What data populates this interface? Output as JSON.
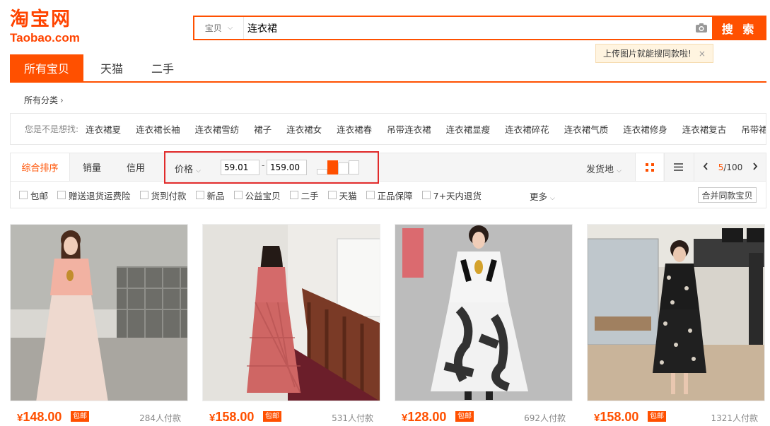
{
  "logo": {
    "cn": "淘宝网",
    "en": "Taobao.com"
  },
  "search": {
    "category": "宝贝",
    "query": "连衣裙",
    "button": "搜 索",
    "tip": "上传图片就能搜同款啦!",
    "tip_close": "×"
  },
  "tabs": [
    {
      "label": "所有宝贝",
      "active": true
    },
    {
      "label": "天猫"
    },
    {
      "label": "二手"
    }
  ],
  "breadcrumb": {
    "label": "所有分类",
    "arrow": "›"
  },
  "suggestions": {
    "label": "您是不是想找:",
    "items": [
      "连衣裙夏",
      "连衣裙长袖",
      "连衣裙雪纺",
      "裙子",
      "连衣裙女",
      "连衣裙春",
      "吊带连衣裙",
      "连衣裙显瘦",
      "连衣裙碎花",
      "连衣裙气质",
      "连衣裙修身",
      "连衣裙复古",
      "吊带裙"
    ]
  },
  "sort": {
    "items": [
      "综合排序",
      "销量",
      "信用"
    ],
    "price_label": "价格",
    "price_min": "59.01",
    "price_dash": "-",
    "price_max": "159.00",
    "ship_from": "发货地",
    "page_current": "5",
    "page_total": "/100"
  },
  "checks": [
    "包邮",
    "赠送退货运费险",
    "货到付款",
    "新品",
    "公益宝贝",
    "二手",
    "天猫",
    "正品保障",
    "7+天内退货"
  ],
  "more_label": "更多",
  "merge_label": "合并同款宝贝",
  "products": [
    {
      "price": "148.00",
      "currency": "¥",
      "badge": "包邮",
      "sold": "284人付款"
    },
    {
      "price": "158.00",
      "currency": "¥",
      "badge": "包邮",
      "sold": "531人付款"
    },
    {
      "price": "128.00",
      "currency": "¥",
      "badge": "包邮",
      "sold": "692人付款"
    },
    {
      "price": "158.00",
      "currency": "¥",
      "badge": "包邮",
      "sold": "1321人付款"
    }
  ],
  "colors": {
    "accent": "#ff5000",
    "highlight_box": "#e12a2a"
  }
}
